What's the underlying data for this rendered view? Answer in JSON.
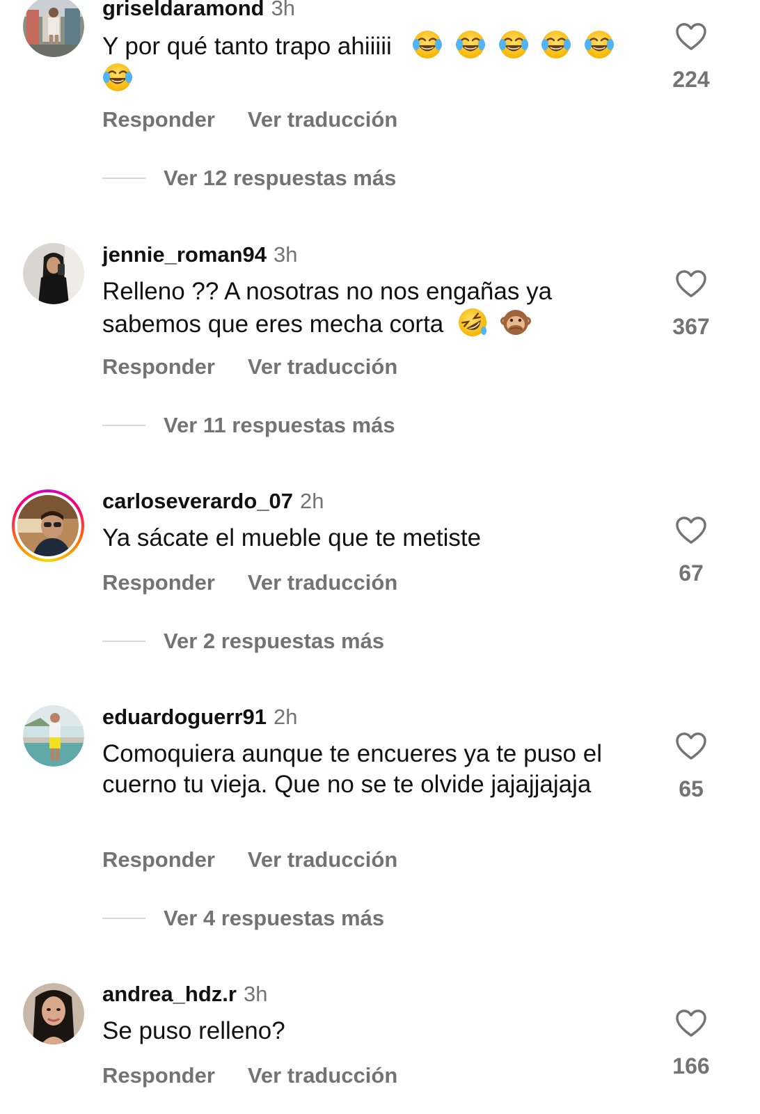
{
  "comments": [
    {
      "username": "griseldaramond",
      "time": "3h",
      "text": "Y por qué tanto trapo ahiiiii",
      "emoji": [
        "face-with-tears-of-joy",
        "face-with-tears-of-joy",
        "face-with-tears-of-joy",
        "face-with-tears-of-joy",
        "face-with-tears-of-joy",
        "face-with-tears-of-joy"
      ],
      "likes": "224",
      "reply_label": "Responder",
      "translate_label": "Ver traducción",
      "view_replies": "Ver 12 respuestas más"
    },
    {
      "username": "jennie_roman94",
      "time": "3h",
      "text": "Relleno ?? A nosotras no nos engañas ya sabemos que eres mecha corta",
      "emoji": [
        "rolling-on-the-floor-laughing",
        "speak-no-evil-monkey"
      ],
      "likes": "367",
      "reply_label": "Responder",
      "translate_label": "Ver traducción",
      "view_replies": "Ver 11 respuestas más"
    },
    {
      "username": "carloseverardo_07",
      "time": "2h",
      "text": "Ya sácate el mueble que te metiste",
      "likes": "67",
      "reply_label": "Responder",
      "translate_label": "Ver traducción",
      "view_replies": "Ver 2 respuestas más"
    },
    {
      "username": "eduardoguerr91",
      "time": "2h",
      "text": "Comoquiera aunque te encueres ya te puso el cuerno tu vieja. Que no se te olvide jajajjajaja",
      "likes": "65",
      "reply_label": "Responder",
      "translate_label": "Ver traducción",
      "view_replies": "Ver 4 respuestas más"
    },
    {
      "username": "andrea_hdz.r",
      "time": "3h",
      "text": "Se puso relleno?",
      "likes": "166",
      "reply_label": "Responder",
      "translate_label": "Ver traducción"
    }
  ],
  "icons": {
    "like": "heart-outline-icon"
  },
  "colors": {
    "text": "#111111",
    "secondary": "#737373",
    "divider": "#d6d6d6",
    "story_ring": [
      "#d300c5",
      "#ff0069",
      "#ff7a00",
      "#ffd600"
    ]
  }
}
